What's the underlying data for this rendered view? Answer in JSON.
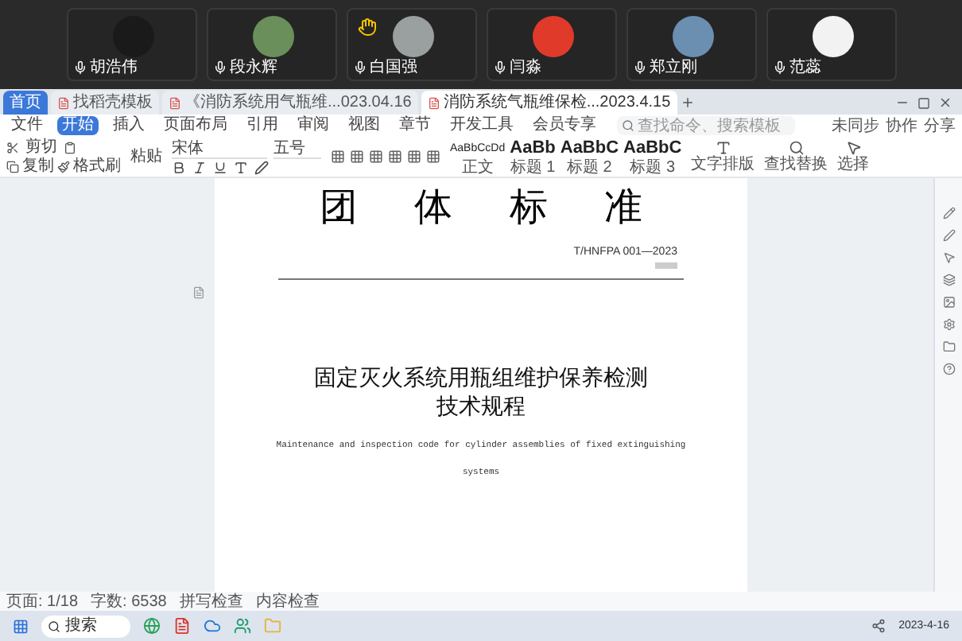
{
  "participants": [
    {
      "name": "胡浩伟",
      "hand_raised": false
    },
    {
      "name": "段永辉",
      "hand_raised": false
    },
    {
      "name": "白国强",
      "hand_raised": true
    },
    {
      "name": "闫淼",
      "hand_raised": false
    },
    {
      "name": "郑立刚",
      "hand_raised": false
    },
    {
      "name": "范蕊",
      "hand_raised": false
    }
  ],
  "browser_tabs": [
    {
      "label": "首页",
      "selected": false
    },
    {
      "label": "找稻壳模板",
      "selected": false
    },
    {
      "label": "《消防系统用气瓶维...023.04.16",
      "selected": false
    },
    {
      "label": "消防系统气瓶维保检...2023.4.15",
      "selected": true
    }
  ],
  "menu": [
    {
      "label": "文件",
      "selected": false
    },
    {
      "label": "开始",
      "selected": true
    },
    {
      "label": "插入",
      "selected": false
    },
    {
      "label": "页面布局",
      "selected": false
    },
    {
      "label": "引用",
      "selected": false
    },
    {
      "label": "审阅",
      "selected": false
    },
    {
      "label": "视图",
      "selected": false
    },
    {
      "label": "章节",
      "selected": false
    },
    {
      "label": "开发工具",
      "selected": false
    },
    {
      "label": "会员专享",
      "selected": false
    }
  ],
  "search": {
    "placeholder": "查找命令、搜索模板"
  },
  "actions": [
    "未同步",
    "协作",
    "分享"
  ],
  "ribbon": {
    "clipboard": [
      "剪切",
      "复制",
      "格式刷"
    ],
    "paste": "粘贴",
    "font": "宋体",
    "size": "五号",
    "styles": [
      {
        "preview": "AaBbCcDd",
        "label": "正文"
      },
      {
        "preview": "AaBb",
        "label": "标题 1"
      },
      {
        "preview": "AaBbC",
        "label": "标题 2"
      },
      {
        "preview": "AaBbC",
        "label": "标题 3"
      }
    ],
    "tools": [
      "文字排版",
      "查找替换",
      "选择"
    ]
  },
  "document": {
    "heading": "团 体 标 准",
    "code": "T/HNFPA 001—2023",
    "title": [
      "固定灭火系统用瓶组维护保养检测",
      "技术规程"
    ],
    "english": [
      "Maintenance and inspection code for cylinder assemblies of fixed extinguishing",
      "systems"
    ]
  },
  "status_bar": [
    "页面: 1/18",
    "字数: 6538",
    "拼写检查",
    "内容检查"
  ],
  "taskbar": {
    "search": "搜索",
    "date": "2023-4-16"
  }
}
